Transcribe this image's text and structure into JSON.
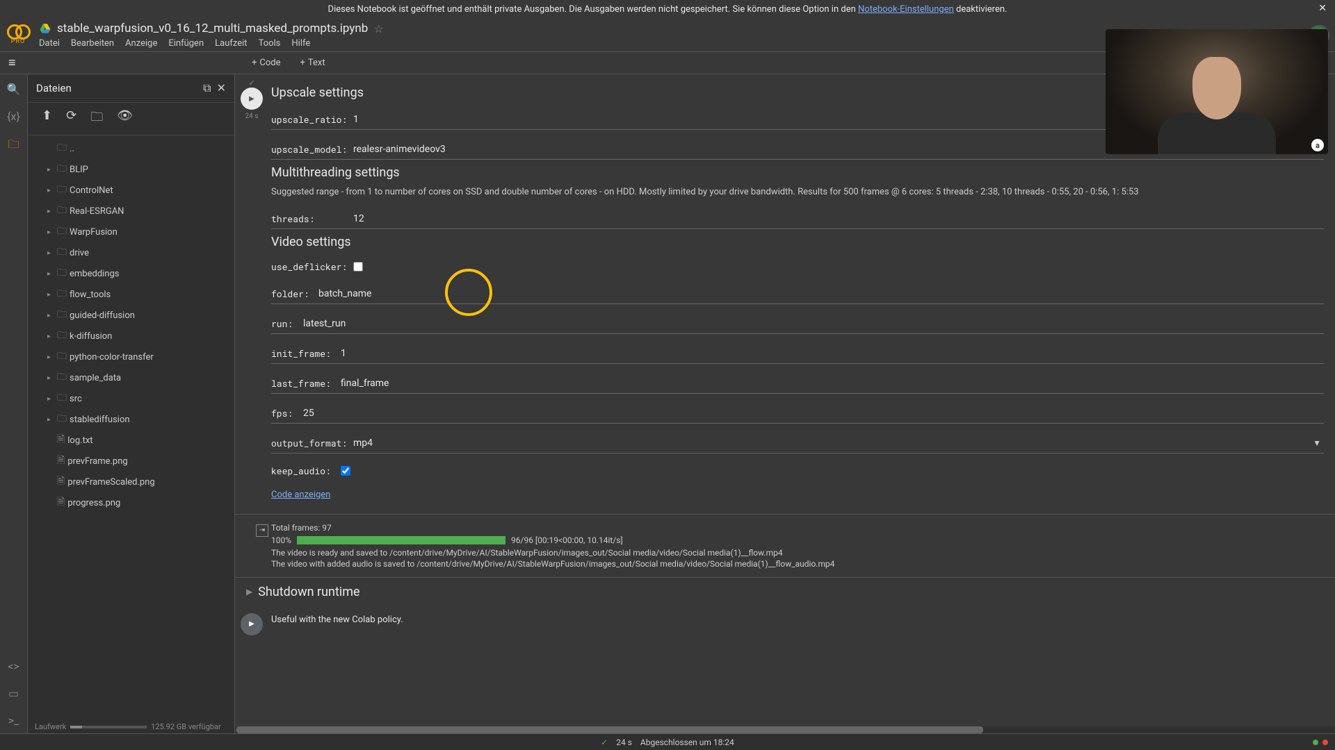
{
  "banner": {
    "text_before": "Dieses Notebook ist geöffnet und enthält private Ausgaben. Die Ausgaben werden nicht gespeichert. Sie können diese Option in den ",
    "link": "Notebook-Einstellungen",
    "text_after": " deaktivieren."
  },
  "header": {
    "pro": "PRO",
    "filename": "stable_warpfusion_v0_16_12_multi_masked_prompts.ipynb",
    "avatar_letter": "a",
    "menu": [
      "Datei",
      "Bearbeiten",
      "Anzeige",
      "Einfügen",
      "Laufzeit",
      "Tools",
      "Hilfe"
    ]
  },
  "toolbar": {
    "code": "Code",
    "text": "Text"
  },
  "files": {
    "title": "Dateien",
    "up": "..",
    "folders": [
      "BLIP",
      "ControlNet",
      "Real-ESRGAN",
      "WarpFusion",
      "drive",
      "embeddings",
      "flow_tools",
      "guided-diffusion",
      "k-diffusion",
      "python-color-transfer",
      "sample_data",
      "src",
      "stablediffusion"
    ],
    "file_items": [
      "log.txt",
      "prevFrame.png",
      "prevFrameScaled.png",
      "progress.png"
    ],
    "disk_label": "Laufwerk",
    "disk_free": "125.92 GB verfügbar"
  },
  "cell": {
    "duration": "24 s",
    "upscale_title": "Upscale settings",
    "upscale_ratio_label": "upscale_ratio:",
    "upscale_ratio_value": "1",
    "upscale_model_label": "upscale_model:",
    "upscale_model_value": "realesr-animevideov3",
    "multi_title": "Multithreading settings",
    "multi_desc": "Suggested range - from 1 to number of cores on SSD and double number of cores - on HDD. Mostly limited by your drive bandwidth. Results for 500 frames @ 6 cores: 5 threads - 2:38, 10 threads - 0:55, 20 - 0:56, 1: 5:53",
    "threads_label": "threads:",
    "threads_value": "12",
    "video_title": "Video settings",
    "use_deflicker_label": "use_deflicker:",
    "folder_label": "folder:",
    "folder_value": "batch_name",
    "run_label": "run:",
    "run_value": "latest_run",
    "init_frame_label": "init_frame:",
    "init_frame_value": "1",
    "last_frame_label": "last_frame:",
    "last_frame_value": "final_frame",
    "fps_label": "fps:",
    "fps_value": "25",
    "output_format_label": "output_format:",
    "output_format_value": "mp4",
    "keep_audio_label": "keep_audio:",
    "show_code": "Code anzeigen"
  },
  "output": {
    "total_frames": "Total frames: 97",
    "pct": "100%",
    "progress_text": "96/96 [00:19<00:00, 10.14it/s]",
    "line1": "The video is ready and saved to /content/drive/MyDrive/AI/StableWarpFusion/images_out/Social media/video/Social media(1)__flow.mp4",
    "line2": "The video with added audio is saved to /content/drive/MyDrive/AI/StableWarpFusion/images_out/Social media/video/Social media(1)__flow_audio.mp4"
  },
  "collapsed": {
    "shutdown": "Shutdown runtime",
    "useful": "Useful with the new Colab policy."
  },
  "status": {
    "duration": "24 s",
    "completed": "Abgeschlossen um 18:24"
  }
}
